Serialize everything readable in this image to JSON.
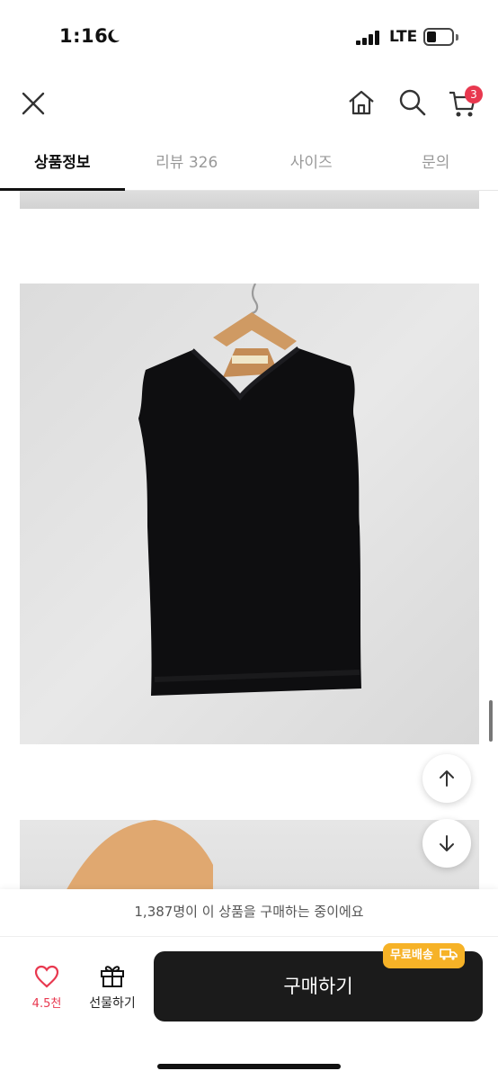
{
  "status_bar": {
    "time": "1:16",
    "network": "LTE"
  },
  "header": {
    "cart_count": "3"
  },
  "tabs": [
    {
      "label": "상품정보"
    },
    {
      "label": "리뷰 326"
    },
    {
      "label": "사이즈"
    },
    {
      "label": "문의"
    }
  ],
  "bottom": {
    "buyer_note": "1,387명이 이 상품을 구매하는 중이에요",
    "like_count": "4.5천",
    "gift_label": "선물하기",
    "buy_label": "구매하기",
    "free_shipping": "무료배송"
  },
  "colors": {
    "accent": "#e8384f",
    "buy_button": "#1b1b1b",
    "badge": "#f6b227"
  }
}
